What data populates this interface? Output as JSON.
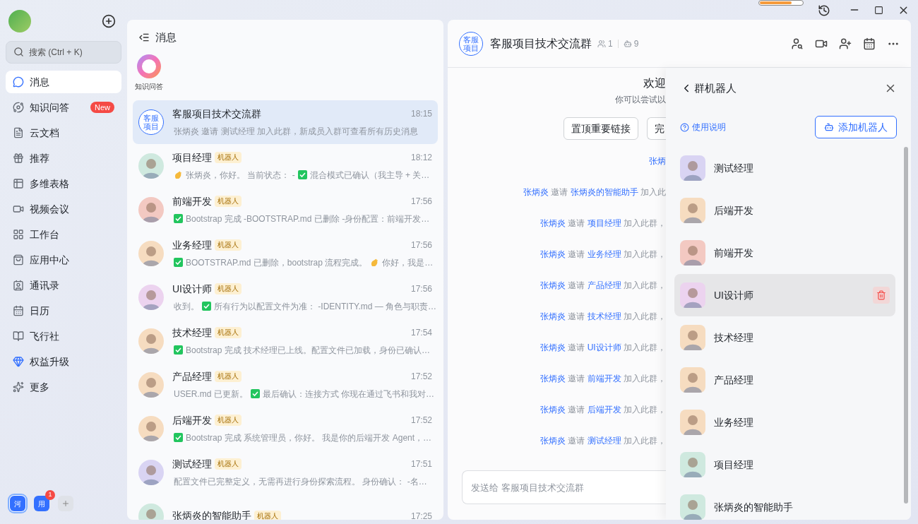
{
  "titlebar": {
    "update_bar": {
      "level": 0.75
    }
  },
  "sidebar": {
    "search": {
      "placeholder": "搜索 (Ctrl + K)"
    },
    "items": [
      {
        "label": "消息",
        "selected": true
      },
      {
        "label": "知识问答",
        "selected": false,
        "badge": "New"
      },
      {
        "label": "云文档",
        "selected": false
      },
      {
        "label": "推荐",
        "selected": false
      },
      {
        "label": "多维表格",
        "selected": false
      },
      {
        "label": "视频会议",
        "selected": false
      },
      {
        "label": "工作台",
        "selected": false
      },
      {
        "label": "应用中心",
        "selected": false
      },
      {
        "label": "通讯录",
        "selected": false
      },
      {
        "label": "日历",
        "selected": false
      },
      {
        "label": "飞行社",
        "selected": false
      },
      {
        "label": "权益升级",
        "selected": false
      },
      {
        "label": "更多",
        "selected": false
      }
    ],
    "workspaces": [
      {
        "label": "河",
        "selected": true
      },
      {
        "label": "用",
        "selected": false,
        "badge": "1"
      }
    ]
  },
  "chat_list": {
    "title": "消息",
    "shortcut": {
      "label": "知识问答"
    },
    "chats": [
      {
        "kind": "group",
        "avatar_lines": [
          "客服",
          "项目"
        ],
        "name": "客服项目技术交流群",
        "time": "18:15",
        "selected": true,
        "preview": [
          {
            "kind": "text",
            "text": "张炳炎 邀请 测试经理 加入此群，新成员入群可查看所有历史消息"
          }
        ]
      },
      {
        "kind": "bot",
        "color": "#cfe9df",
        "name": "项目经理",
        "tag": "机器人",
        "time": "18:12",
        "selected": false,
        "preview": [
          {
            "kind": "wave"
          },
          {
            "kind": "text",
            "text": "张炳炎，你好。 当前状态： -"
          },
          {
            "kind": "check"
          },
          {
            "kind": "text",
            "text": "混合模式已确认（我主导 + 关…"
          }
        ]
      },
      {
        "kind": "bot",
        "color": "#f3c9c2",
        "name": "前端开发",
        "tag": "机器人",
        "time": "17:56",
        "selected": false,
        "preview": [
          {
            "kind": "check"
          },
          {
            "kind": "text",
            "text": "Bootstrap 完成 -BOOTSTRAP.md 已删除 -身份配置：前端开发…"
          }
        ]
      },
      {
        "kind": "bot",
        "color": "#f6dcc0",
        "name": "业务经理",
        "tag": "机器人",
        "time": "17:56",
        "selected": false,
        "preview": [
          {
            "kind": "check"
          },
          {
            "kind": "text",
            "text": "BOOTSTRAP.md 已删除，bootstrap 流程完成。"
          },
          {
            "kind": "wave"
          },
          {
            "kind": "text",
            "text": "你好，我是…"
          }
        ]
      },
      {
        "kind": "bot",
        "color": "#ecd3ef",
        "name": "UI设计师",
        "tag": "机器人",
        "time": "17:56",
        "selected": false,
        "preview": [
          {
            "kind": "text",
            "text": "收到。"
          },
          {
            "kind": "check"
          },
          {
            "kind": "text",
            "text": "所有行为以配置文件为准： -IDENTITY.md — 角色与职责…"
          }
        ]
      },
      {
        "kind": "bot",
        "color": "#f6dcc0",
        "name": "技术经理",
        "tag": "机器人",
        "time": "17:54",
        "selected": false,
        "preview": [
          {
            "kind": "check"
          },
          {
            "kind": "text",
            "text": "Bootstrap 完成 技术经理已上线。配置文件已加载，身份已确认…"
          }
        ]
      },
      {
        "kind": "bot",
        "color": "#f6dcc0",
        "name": "产品经理",
        "tag": "机器人",
        "time": "17:52",
        "selected": false,
        "preview": [
          {
            "kind": "text",
            "text": "USER.md 已更新。"
          },
          {
            "kind": "check"
          },
          {
            "kind": "text",
            "text": "最后确认：连接方式 你现在通过飞书和我对…"
          }
        ]
      },
      {
        "kind": "bot",
        "color": "#f6dcc0",
        "name": "后端开发",
        "tag": "机器人",
        "time": "17:52",
        "selected": false,
        "preview": [
          {
            "kind": "check"
          },
          {
            "kind": "text",
            "text": "Bootstrap 完成 系统管理员，你好。 我是你的后端开发 Agent，…"
          }
        ]
      },
      {
        "kind": "bot",
        "color": "#d9d4f3",
        "name": "测试经理",
        "tag": "机器人",
        "time": "17:51",
        "selected": false,
        "preview": [
          {
            "kind": "text",
            "text": "配置文件已完整定义，无需再进行身份探索流程。 身份确认： -名…"
          }
        ]
      },
      {
        "kind": "bot",
        "color": "#cfe9df",
        "name": "张炳炎的智能助手",
        "tag": "机器人",
        "time": "17:25",
        "selected": false
      }
    ]
  },
  "chat": {
    "avatar_lines": [
      "客服",
      "项目"
    ],
    "title": "客服项目技术交流群",
    "members": "1",
    "bots": "9",
    "welcome": {
      "title": "欢迎",
      "subtitle": "你可以尝试以",
      "buttons": [
        "置顶重要链接",
        "完"
      ]
    },
    "messages": [
      {
        "parts": [
          {
            "kind": "user",
            "text": "张炳"
          }
        ]
      },
      {
        "parts": [
          {
            "kind": "user",
            "text": "张炳炎"
          },
          {
            "kind": "text",
            "text": "邀请"
          },
          {
            "kind": "user",
            "text": "张炳炎的智能助手"
          },
          {
            "kind": "text",
            "text": "加入此"
          }
        ]
      },
      {
        "parts": [
          {
            "kind": "user",
            "text": "张炳炎"
          },
          {
            "kind": "text",
            "text": "邀请"
          },
          {
            "kind": "user",
            "text": "项目经理"
          },
          {
            "kind": "text",
            "text": "加入此群，"
          }
        ]
      },
      {
        "parts": [
          {
            "kind": "user",
            "text": "张炳炎"
          },
          {
            "kind": "text",
            "text": "邀请"
          },
          {
            "kind": "user",
            "text": "业务经理"
          },
          {
            "kind": "text",
            "text": "加入此群，"
          }
        ]
      },
      {
        "parts": [
          {
            "kind": "user",
            "text": "张炳炎"
          },
          {
            "kind": "text",
            "text": "邀请"
          },
          {
            "kind": "user",
            "text": "产品经理"
          },
          {
            "kind": "text",
            "text": "加入此群，"
          }
        ]
      },
      {
        "parts": [
          {
            "kind": "user",
            "text": "张炳炎"
          },
          {
            "kind": "text",
            "text": "邀请"
          },
          {
            "kind": "user",
            "text": "技术经理"
          },
          {
            "kind": "text",
            "text": "加入此群，"
          }
        ]
      },
      {
        "parts": [
          {
            "kind": "user",
            "text": "张炳炎"
          },
          {
            "kind": "text",
            "text": "邀请"
          },
          {
            "kind": "user",
            "text": "UI设计师"
          },
          {
            "kind": "text",
            "text": "加入此群，"
          }
        ]
      },
      {
        "parts": [
          {
            "kind": "user",
            "text": "张炳炎"
          },
          {
            "kind": "text",
            "text": "邀请"
          },
          {
            "kind": "user",
            "text": "前端开发"
          },
          {
            "kind": "text",
            "text": "加入此群，"
          }
        ]
      },
      {
        "parts": [
          {
            "kind": "user",
            "text": "张炳炎"
          },
          {
            "kind": "text",
            "text": "邀请"
          },
          {
            "kind": "user",
            "text": "后端开发"
          },
          {
            "kind": "text",
            "text": "加入此群，"
          }
        ]
      },
      {
        "parts": [
          {
            "kind": "user",
            "text": "张炳炎"
          },
          {
            "kind": "text",
            "text": "邀请"
          },
          {
            "kind": "user",
            "text": "测试经理"
          },
          {
            "kind": "text",
            "text": "加入此群，"
          }
        ]
      }
    ],
    "composer": {
      "placeholder": "发送给 客服项目技术交流群"
    }
  },
  "bot_panel": {
    "title": "群机器人",
    "help_link": "使用说明",
    "add_button": "添加机器人",
    "bots": [
      {
        "name": "测试经理",
        "color": "#d9d4f3",
        "selected": false
      },
      {
        "name": "后端开发",
        "color": "#f6dcc0",
        "selected": false
      },
      {
        "name": "前端开发",
        "color": "#f3c9c2",
        "selected": false
      },
      {
        "name": "UI设计师",
        "color": "#ecd3ef",
        "selected": true
      },
      {
        "name": "技术经理",
        "color": "#f6dcc0",
        "selected": false
      },
      {
        "name": "产品经理",
        "color": "#f6dcc0",
        "selected": false
      },
      {
        "name": "业务经理",
        "color": "#f6dcc0",
        "selected": false
      },
      {
        "name": "项目经理",
        "color": "#cfe9df",
        "selected": false
      },
      {
        "name": "张炳炎的智能助手",
        "color": "#cfe9df",
        "selected": false
      }
    ]
  }
}
